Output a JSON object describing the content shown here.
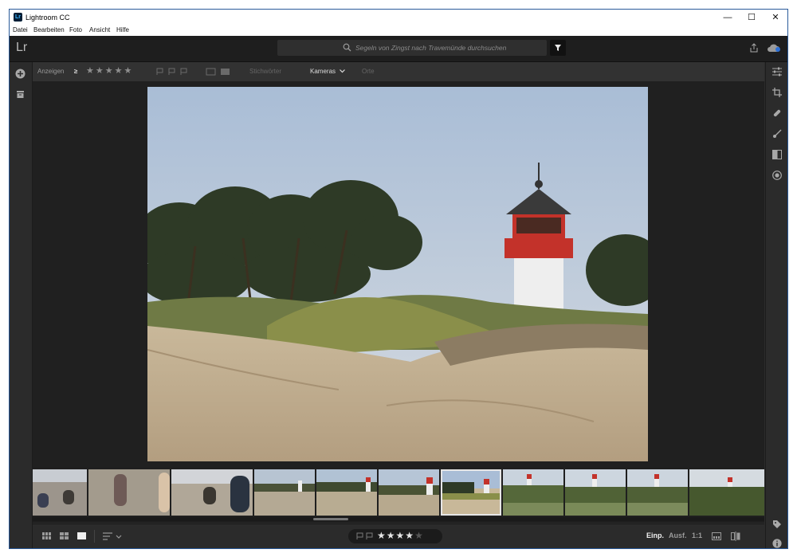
{
  "window": {
    "title": "Lightroom CC",
    "app_icon_text": "Lr"
  },
  "window_controls": {
    "minimize": "—",
    "maximize": "☐",
    "close": "✕"
  },
  "menu": {
    "items": [
      "Datei",
      "Bearbeiten",
      "Foto",
      "Ansicht",
      "Hilfe"
    ]
  },
  "topbar": {
    "logo": "Lr",
    "search_placeholder": "Segeln von Zingst nach Travemünde durchsuchen"
  },
  "filterbar": {
    "show_label": "Anzeigen",
    "compare": "≥",
    "stars": [
      "★",
      "★",
      "★",
      "★",
      "★"
    ],
    "keywords": "Stichwörter",
    "cameras": "Kameras",
    "places": "Orte"
  },
  "left_tools": [
    "add-photos-icon",
    "albums-icon"
  ],
  "right_tools": [
    "edit-sliders-icon",
    "crop-icon",
    "healing-icon",
    "brush-icon",
    "linear-gradient-icon",
    "radial-gradient-icon",
    "keyword-tag-icon",
    "info-icon"
  ],
  "main_photo": {
    "subject": "lighthouse on dune",
    "sky": "#b9c8d9"
  },
  "filmstrip": {
    "thumb_count": 12,
    "selected_index": 6
  },
  "bottombar": {
    "rating_stars": [
      "★",
      "★",
      "★",
      "★",
      "★"
    ],
    "rating_value": 4,
    "view_fit": "Einp.",
    "view_fill": "Ausf.",
    "view_1to1": "1:1"
  },
  "colors": {
    "accent": "#ffffff",
    "panel": "#2b2b2b",
    "dark": "#1e1e1e"
  }
}
